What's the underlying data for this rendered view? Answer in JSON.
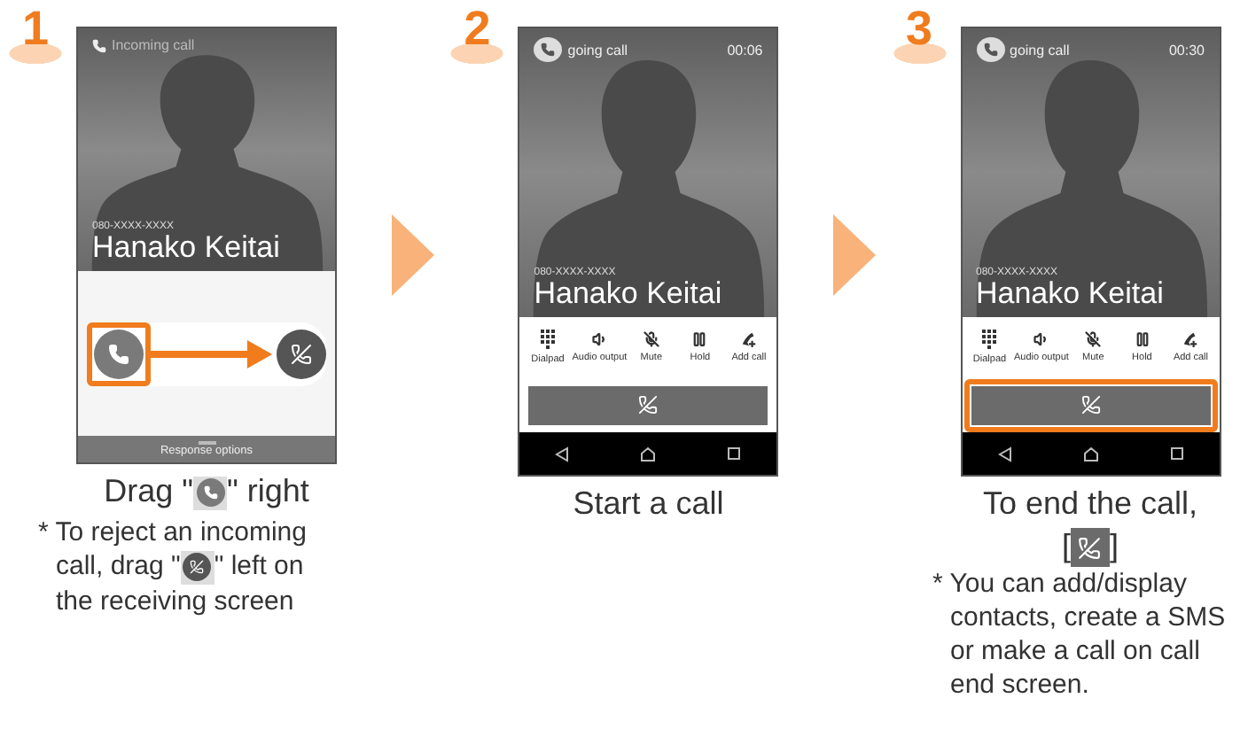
{
  "steps": [
    {
      "number": "1",
      "kind": "incoming",
      "phone": {
        "status": "Incoming call",
        "number": "080-XXXX-XXXX",
        "name": "Hanako Keitai",
        "answer_highlighted": true,
        "footer": "Response options"
      },
      "caption": [
        {
          "kind": "text",
          "text": "Drag \""
        },
        {
          "kind": "answer"
        },
        {
          "kind": "text",
          "text": "\" right"
        }
      ],
      "note": [
        [
          {
            "kind": "text",
            "text": "* To reject an incoming"
          }
        ],
        [
          {
            "kind": "text",
            "text": "call, drag \""
          },
          {
            "kind": "decline"
          },
          {
            "kind": "text",
            "text": "\" left on"
          }
        ],
        [
          {
            "kind": "text",
            "text": "the receiving screen"
          }
        ]
      ]
    },
    {
      "number": "2",
      "kind": "ongoing",
      "phone": {
        "status": "going call",
        "timer": "00:06",
        "number": "080-XXXX-XXXX",
        "name": "Hanako Keitai",
        "actions": [
          {
            "kind": "dialpad",
            "label": "Dialpad"
          },
          {
            "kind": "audio",
            "label": "Audio output"
          },
          {
            "kind": "mute",
            "label": "Mute"
          },
          {
            "kind": "hold",
            "label": "Hold"
          },
          {
            "kind": "add",
            "label": "Add call"
          }
        ],
        "end_highlighted": false
      },
      "caption": [
        {
          "kind": "text",
          "text": "Start a call"
        }
      ]
    },
    {
      "number": "3",
      "kind": "ongoing",
      "phone": {
        "status": "going call",
        "timer": "00:30",
        "number": "080-XXXX-XXXX",
        "name": "Hanako Keitai",
        "actions": [
          {
            "kind": "dialpad",
            "label": "Dialpad"
          },
          {
            "kind": "audio",
            "label": "Audio output"
          },
          {
            "kind": "mute",
            "label": "Mute"
          },
          {
            "kind": "hold",
            "label": "Hold"
          },
          {
            "kind": "add",
            "label": "Add call"
          }
        ],
        "end_highlighted": true
      },
      "caption": [
        {
          "kind": "text",
          "text": "To end the call,"
        },
        {
          "kind": "break"
        },
        {
          "kind": "text",
          "text": "["
        },
        {
          "kind": "end"
        },
        {
          "kind": "text",
          "text": "]"
        }
      ],
      "note": [
        [
          {
            "kind": "text",
            "text": "* You can add/display contacts, create a SMS or make a call on call end screen."
          }
        ]
      ]
    }
  ]
}
